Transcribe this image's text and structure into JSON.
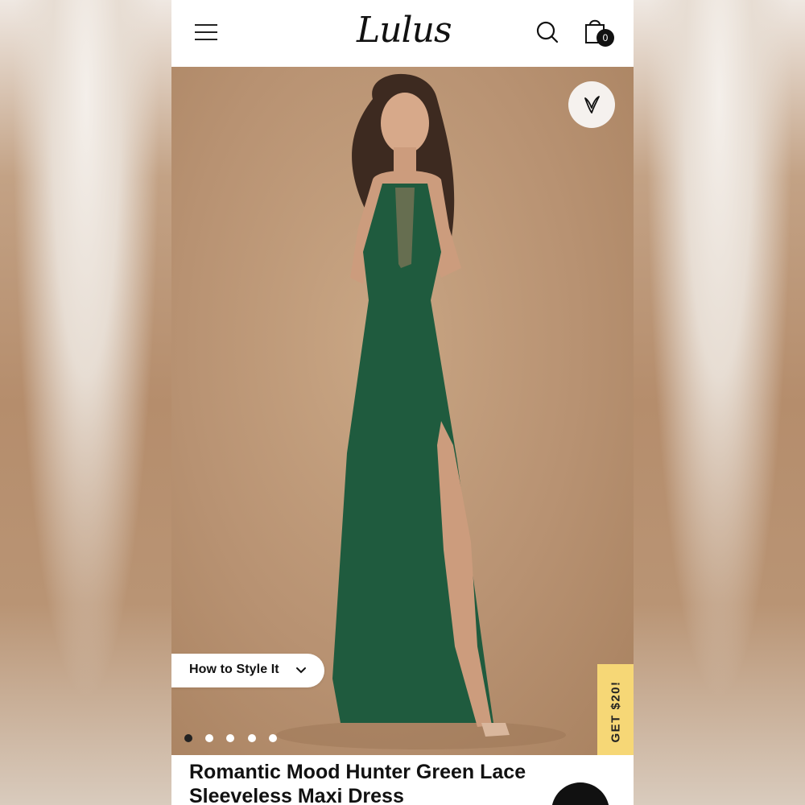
{
  "header": {
    "logo": "Lulus",
    "bag_count": "0",
    "icons": [
      "hamburger-menu-icon",
      "search-icon",
      "shopping-bag-icon"
    ]
  },
  "product": {
    "image_alt": "Model wearing green lace sleeveless maxi dress",
    "style_link": "How to Style It",
    "promo": "GET $20!",
    "title": "Romantic Mood Hunter Green Lace Sleeveless Maxi Dress",
    "image_count": 5,
    "active_image": 1
  },
  "colors": {
    "dress": "#1f5b3e",
    "promo": "#f6d776",
    "background": "#b89272"
  }
}
